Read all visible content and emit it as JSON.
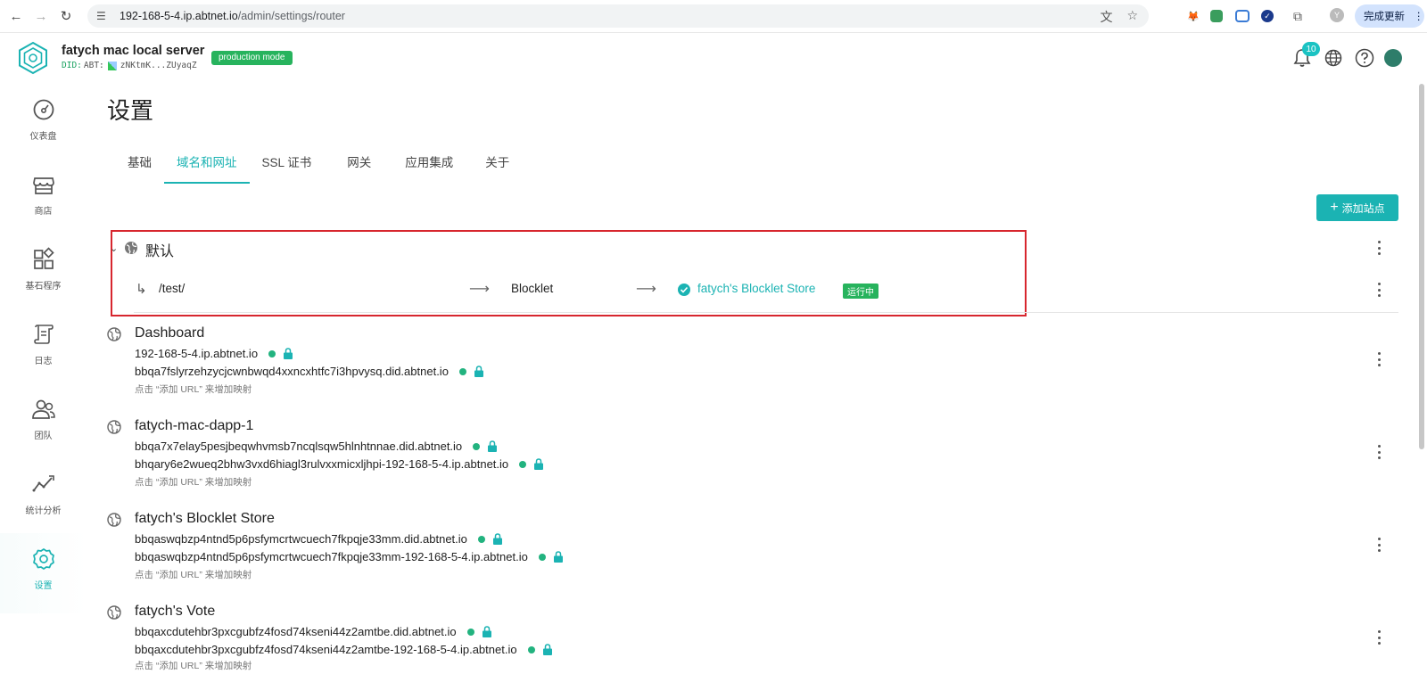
{
  "browser": {
    "url_host": "192-168-5-4.ip.abtnet.io",
    "url_path": "/admin/settings/router",
    "profile_initial": "Y",
    "update_label": "完成更新"
  },
  "header": {
    "server_name": "fatych mac local server",
    "did_prefix": "DID:",
    "did_type": "ABT:",
    "did_value": "zNKtmK...ZUyaqZ",
    "mode_badge": "production mode",
    "notification_count": "10"
  },
  "sidebar": {
    "items": [
      {
        "label": "仪表盘",
        "icon": "dashboard-icon"
      },
      {
        "label": "商店",
        "icon": "store-icon"
      },
      {
        "label": "基石程序",
        "icon": "blocklet-icon"
      },
      {
        "label": "日志",
        "icon": "log-icon"
      },
      {
        "label": "团队",
        "icon": "team-icon"
      },
      {
        "label": "统计分析",
        "icon": "analytics-icon"
      },
      {
        "label": "设置",
        "icon": "settings-icon",
        "active": true
      }
    ]
  },
  "page": {
    "title": "设置",
    "tabs": [
      "基础",
      "域名和网址",
      "SSL 证书",
      "网关",
      "应用集成",
      "关于"
    ],
    "active_tab": "域名和网址",
    "add_site_label": "添加站点"
  },
  "default_site": {
    "name": "默认",
    "rule": {
      "path": "/test/",
      "target_type": "Blocklet",
      "target_name": "fatych's Blocklet Store",
      "status": "运行中"
    }
  },
  "sites": [
    {
      "name": "Dashboard",
      "domains": [
        "192-168-5-4.ip.abtnet.io",
        "bbqa7fslyrzehzycjcwnbwqd4xxncxhtfc7i3hpvysq.did.abtnet.io"
      ],
      "hint": "点击 “添加 URL” 来增加映射"
    },
    {
      "name": "fatych-mac-dapp-1",
      "domains": [
        "bbqa7x7elay5pesjbeqwhvmsb7ncqlsqw5hlnhtnnae.did.abtnet.io",
        "bhqary6e2wueq2bhw3vxd6hiagl3rulvxxmicxljhpi-192-168-5-4.ip.abtnet.io"
      ],
      "hint": "点击 “添加 URL” 来增加映射"
    },
    {
      "name": "fatych's Blocklet Store",
      "domains": [
        "bbqaswqbzp4ntnd5p6psfymcrtwcuech7fkpqje33mm.did.abtnet.io",
        "bbqaswqbzp4ntnd5p6psfymcrtwcuech7fkpqje33mm-192-168-5-4.ip.abtnet.io"
      ],
      "hint": "点击 “添加 URL” 来增加映射"
    },
    {
      "name": "fatych's Vote",
      "domains": [
        "bbqaxcdutehbr3pxcgubfz4fosd74kseni44z2amtbe.did.abtnet.io",
        "bbqaxcdutehbr3pxcgubfz4fosd74kseni44z2amtbe-192-168-5-4.ip.abtnet.io"
      ],
      "hint": "点击 “添加 URL” 来增加映射"
    }
  ],
  "colors": {
    "accent": "#1bb3b3",
    "running": "#27b35d",
    "highlight_box": "#d7262e"
  }
}
